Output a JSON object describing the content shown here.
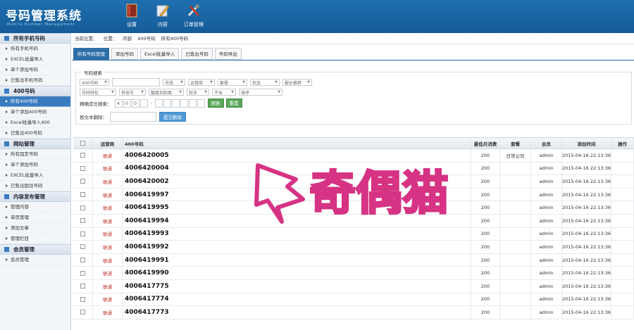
{
  "header": {
    "title": "号码管理系统",
    "subtitle": "Mobile Number Management",
    "nav": [
      {
        "label": "设置",
        "icon": "book-icon"
      },
      {
        "label": "内容",
        "icon": "edit-icon"
      },
      {
        "label": "订单管理",
        "icon": "tools-icon"
      }
    ]
  },
  "sidebar": [
    {
      "title": "所有手机号码",
      "items": [
        "所有手机号码",
        "EXCEL批量导入",
        "单个添加号码",
        "已售出手机号码"
      ]
    },
    {
      "title": "400号码",
      "items": [
        "所有400号码",
        "单个添加400号码",
        "Excel批量导入400",
        "已售出400号码"
      ],
      "active": 0
    },
    {
      "title": "网站管理",
      "items": [
        "所有固定号码",
        "单个添加号码",
        "EXCEL批量导入",
        "已售出固话号码"
      ]
    },
    {
      "title": "内容发布管理",
      "items": [
        "管理内容",
        "单页管理",
        "添加文章",
        "管理栏目"
      ]
    },
    {
      "title": "会员管理",
      "items": [
        "会员管理"
      ]
    }
  ],
  "breadcrumb": [
    "当前位置：",
    "位置：",
    "内容",
    "400号码",
    "所有400号码"
  ],
  "tabs": [
    "所有号码管理",
    "添加号码",
    "Excel批量导入",
    "已售出号码",
    "号码导出"
  ],
  "search": {
    "legend": "号码搜索",
    "row1": [
      "400号码",
      "号段",
      "运营商",
      "套餐",
      "状态",
      "报价推荐"
    ],
    "row2": [
      "号码特征",
      "有效号",
      "靓度到前面",
      "较多",
      "不含",
      "排序"
    ],
    "exact_label": "精确定位搜索：",
    "digits": [
      "4",
      "0",
      "0",
      "",
      "-",
      "",
      "",
      "",
      "",
      "",
      ""
    ],
    "search_btn": "搜索",
    "reset_btn": "重置",
    "delete_label": "按文本删除：",
    "submit_btn": "提交删除"
  },
  "table": {
    "headers": [
      "",
      "运营商",
      "400号码",
      "最低月消费",
      "套餐",
      "会员",
      "添加时间",
      "操作"
    ],
    "rows": [
      {
        "status": "联通",
        "number": "4006420005",
        "fee": "200",
        "package": "日常公司",
        "member": "admin",
        "time": "2015-04-16 22:13:36"
      },
      {
        "status": "联通",
        "number": "4006420004",
        "fee": "200",
        "package": "",
        "member": "admin",
        "time": "2015-04-16 22:13:36"
      },
      {
        "status": "联通",
        "number": "4006420002",
        "fee": "200",
        "package": "",
        "member": "admin",
        "time": "2015-04-16 22:13:36"
      },
      {
        "status": "联通",
        "number": "4006419997",
        "fee": "200",
        "package": "",
        "member": "admin",
        "time": "2015-04-16 22:13:36"
      },
      {
        "status": "联通",
        "number": "4006419995",
        "fee": "200",
        "package": "",
        "member": "admin",
        "time": "2015-04-16 22:13:36"
      },
      {
        "status": "联通",
        "number": "4006419994",
        "fee": "200",
        "package": "",
        "member": "admin",
        "time": "2015-04-16 22:13:36"
      },
      {
        "status": "联通",
        "number": "4006419993",
        "fee": "200",
        "package": "",
        "member": "admin",
        "time": "2015-04-16 22:13:36"
      },
      {
        "status": "联通",
        "number": "4006419992",
        "fee": "200",
        "package": "",
        "member": "admin",
        "time": "2015-04-16 22:13:36"
      },
      {
        "status": "联通",
        "number": "4006419991",
        "fee": "200",
        "package": "",
        "member": "admin",
        "time": "2015-04-16 22:13:36"
      },
      {
        "status": "联通",
        "number": "4006419990",
        "fee": "200",
        "package": "",
        "member": "admin",
        "time": "2015-04-16 22:13:36"
      },
      {
        "status": "联通",
        "number": "4006417775",
        "fee": "200",
        "package": "",
        "member": "admin",
        "time": "2015-04-16 22:13:36"
      },
      {
        "status": "联通",
        "number": "4006417774",
        "fee": "200",
        "package": "",
        "member": "admin",
        "time": "2015-04-16 22:13:36"
      },
      {
        "status": "联通",
        "number": "4006417773",
        "fee": "200",
        "package": "",
        "member": "admin",
        "time": "2015-04-16 22:13:36"
      }
    ]
  },
  "watermark": {
    "text": "奇偶猫",
    "color": "#d63384"
  }
}
